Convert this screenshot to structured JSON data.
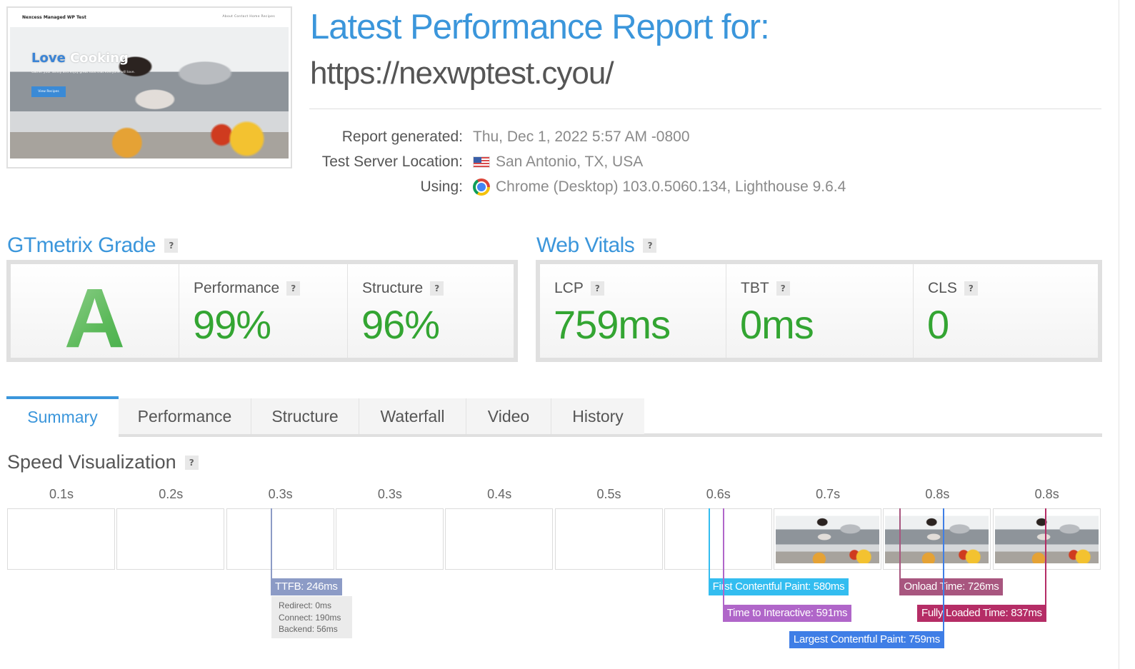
{
  "thumbnail": {
    "site_name": "Nexcess Managed WP Test",
    "nav_links": "About   Contact   Home   Recipes",
    "hero_title_accent": "Love",
    "hero_title": "Cooking",
    "hero_subtitle": "Gather your family and enjoy great food that everyone will love.",
    "hero_button": "View Recipes"
  },
  "header": {
    "title": "Latest Performance Report for:",
    "url": "https://nexwptest.cyou/"
  },
  "meta": {
    "report_generated_label": "Report generated:",
    "report_generated_value": "Thu, Dec 1, 2022 5:57 AM -0800",
    "location_label": "Test Server Location:",
    "location_value": "San Antonio, TX, USA",
    "location_icon": "us-flag-icon",
    "using_label": "Using:",
    "using_value": "Chrome (Desktop) 103.0.5060.134, Lighthouse 9.6.4",
    "using_icon": "chrome-icon"
  },
  "grade": {
    "title": "GTmetrix Grade",
    "help": "?",
    "letter": "A",
    "performance_label": "Performance",
    "performance_value": "99%",
    "structure_label": "Structure",
    "structure_value": "96%"
  },
  "vitals": {
    "title": "Web Vitals",
    "help": "?",
    "lcp_label": "LCP",
    "lcp_value": "759ms",
    "tbt_label": "TBT",
    "tbt_value": "0ms",
    "cls_label": "CLS",
    "cls_value": "0"
  },
  "tabs": [
    {
      "label": "Summary",
      "active": true
    },
    {
      "label": "Performance",
      "active": false
    },
    {
      "label": "Structure",
      "active": false
    },
    {
      "label": "Waterfall",
      "active": false
    },
    {
      "label": "Video",
      "active": false
    },
    {
      "label": "History",
      "active": false
    }
  ],
  "speed": {
    "title": "Speed Visualization",
    "help": "?",
    "frames": [
      {
        "time": "0.1s",
        "has_content": false
      },
      {
        "time": "0.2s",
        "has_content": false
      },
      {
        "time": "0.3s",
        "has_content": false
      },
      {
        "time": "0.3s",
        "has_content": false
      },
      {
        "time": "0.4s",
        "has_content": false
      },
      {
        "time": "0.5s",
        "has_content": false
      },
      {
        "time": "0.6s",
        "has_content": false
      },
      {
        "time": "0.7s",
        "has_content": true
      },
      {
        "time": "0.8s",
        "has_content": true
      },
      {
        "time": "0.8s",
        "has_content": true
      }
    ],
    "markers": {
      "ttfb": {
        "label": "TTFB: 246ms",
        "ms": 246,
        "color": "#8c9bc6"
      },
      "fcp": {
        "label": "First Contentful Paint: 580ms",
        "ms": 580,
        "color": "#33bdf0"
      },
      "tti": {
        "label": "Time to Interactive: 591ms",
        "ms": 591,
        "color": "#b066c9"
      },
      "onload": {
        "label": "Onload Time: 726ms",
        "ms": 726,
        "color": "#a8567f"
      },
      "fully_loaded": {
        "label": "Fully Loaded Time: 837ms",
        "ms": 837,
        "color": "#b52d66"
      },
      "lcp": {
        "label": "Largest Contentful Paint: 759ms",
        "ms": 759,
        "color": "#3f7ee6"
      }
    },
    "ttfb_details": {
      "redirect": "Redirect: 0ms",
      "connect": "Connect: 190ms",
      "backend": "Backend: 56ms"
    }
  },
  "colors": {
    "accent": "#3b96db",
    "good": "#33a532"
  }
}
